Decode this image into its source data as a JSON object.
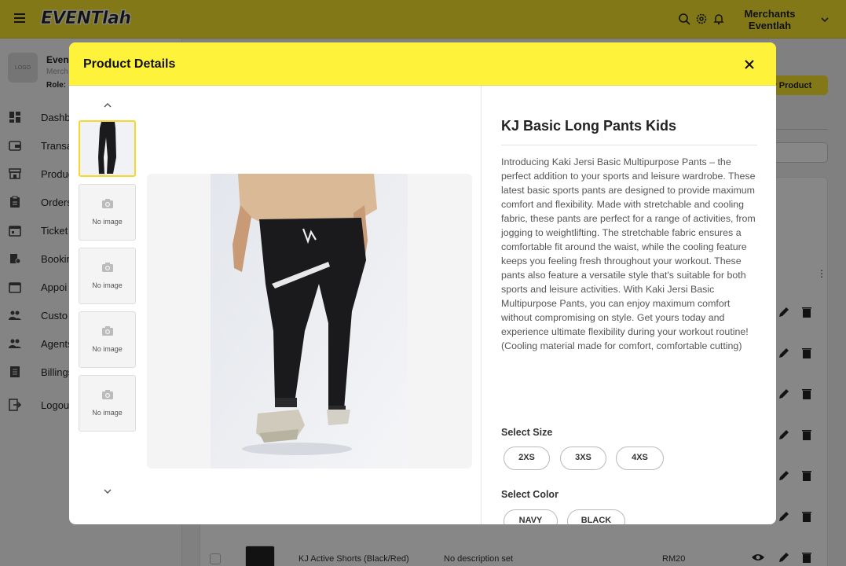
{
  "app": {
    "logo_text": "EVENTlah",
    "merchant_line1": "Merchants",
    "merchant_line2": "Eventlah"
  },
  "sidebar": {
    "logo_placeholder": "LOGO",
    "store_name": "Even",
    "store_sub": "Merch",
    "store_role": "Role:",
    "items": [
      {
        "label": "Dashb",
        "icon": "dashboard-icon"
      },
      {
        "label": "Transa",
        "icon": "wallet-icon"
      },
      {
        "label": "Produc",
        "icon": "store-icon"
      },
      {
        "label": "Orders",
        "icon": "clipboard-icon"
      },
      {
        "label": "Ticket",
        "icon": "calendar-icon"
      },
      {
        "label": "Bookin",
        "icon": "booking-icon"
      },
      {
        "label": "Appoi",
        "icon": "calendar-icon"
      },
      {
        "label": "Custo",
        "icon": "people-icon"
      },
      {
        "label": "Agents",
        "icon": "people-icon"
      },
      {
        "label": "Billings",
        "icon": "receipt-icon"
      },
      {
        "label": "Logou",
        "icon": "logout-icon"
      }
    ]
  },
  "main": {
    "new_product_label": "ew Product",
    "last_row": {
      "name": "KJ Active Shorts (Black/Red)",
      "description": "No description set",
      "price": "RM20"
    }
  },
  "modal": {
    "title": "Product Details",
    "thumbnails": [
      {
        "active": true,
        "label": ""
      },
      {
        "active": false,
        "label": "No image"
      },
      {
        "active": false,
        "label": "No image"
      },
      {
        "active": false,
        "label": "No image"
      },
      {
        "active": false,
        "label": "No image"
      }
    ],
    "product": {
      "name": "KJ Basic Long Pants Kids",
      "description": "Introducing Kaki Jersi Basic Multipurpose Pants – the perfect addition to your sports and leisure wardrobe. These latest basic sports pants are designed to provide maximum comfort and flexibility. Made with stretchable and cooling fabric, these pants are perfect for a range of activities, from jogging to weightlifting. The stretchable fabric ensures a comfortable fit around the waist, while the cooling feature keeps you feeling fresh throughout your workout. These pants also feature a versatile style that's suitable for both sports and leisure activities. With Kaki Jersi Basic Multipurpose Pants, you can enjoy maximum comfort without compromising on style. Get yours today and experience ultimate flexibility during your workout routine! (Cooling material made for comfort, comfortable cutting)",
      "size_label": "Select Size",
      "sizes": [
        "2XS",
        "3XS",
        "4XS"
      ],
      "color_label": "Select Color",
      "colors": [
        "NAVY",
        "BLACK"
      ]
    }
  },
  "colors": {
    "brand_yellow": "#f5e22f",
    "header_yellow": "#fff23a"
  }
}
